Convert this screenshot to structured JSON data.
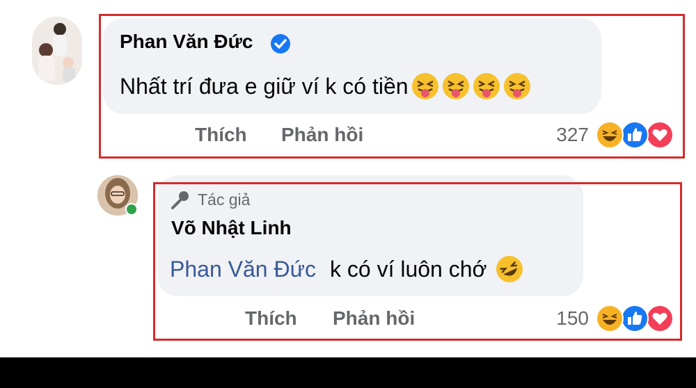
{
  "comment1": {
    "author": "Phan Văn Đức",
    "verified_icon": "verified-badge-icon",
    "text": "Nhất trí đưa e giữ ví k có tiền",
    "emojis": [
      "squinting-tongue-emoji",
      "squinting-tongue-emoji",
      "squinting-tongue-emoji",
      "squinting-tongue-emoji"
    ],
    "like_label": "Thích",
    "reply_label": "Phản hồi",
    "reaction_count": "327"
  },
  "comment2": {
    "badge_label": "Tác giả",
    "badge_icon": "microphone-icon",
    "author": "Võ Nhật Linh",
    "mention": "Phan Văn Đức",
    "text": "k có ví luôn chớ",
    "emoji": "rolling-laughing-emoji",
    "like_label": "Thích",
    "reply_label": "Phản hồi",
    "reaction_count": "150"
  },
  "colors": {
    "bubble": "#f0f2f5",
    "highlight_box": "#d62a2a",
    "mention": "#385898",
    "verified": "#1877f2",
    "like": "#1877f2",
    "love": "#f33e58",
    "haha": "#f7b125",
    "online": "#31a24c"
  }
}
